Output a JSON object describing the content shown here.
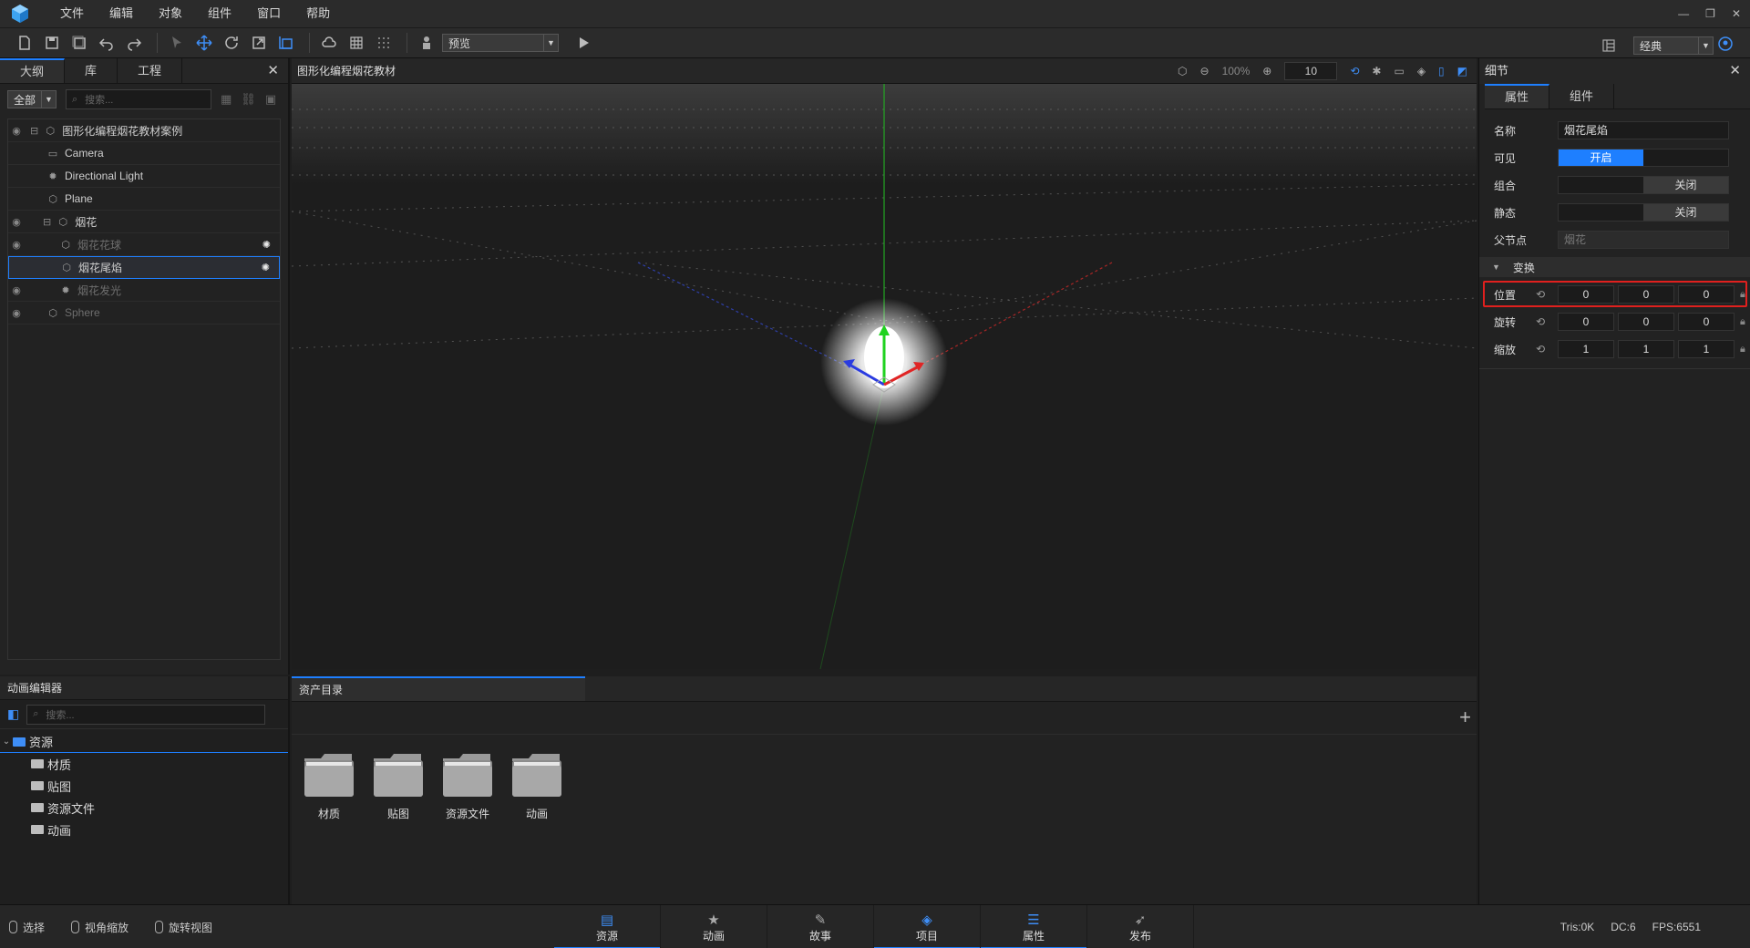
{
  "menu": [
    "文件",
    "编辑",
    "对象",
    "组件",
    "窗口",
    "帮助"
  ],
  "toolbar": {
    "preview_select": "预览",
    "layout_select": "经典"
  },
  "outline": {
    "tabs": [
      "大纲",
      "库",
      "工程"
    ],
    "filter_select": "全部",
    "search_placeholder": "搜索...",
    "tree": [
      {
        "label": "图形化编程烟花教材案例",
        "level": 0,
        "icon": "object-icon",
        "eye": true,
        "dim": false,
        "selected": false
      },
      {
        "label": "Camera",
        "level": 1,
        "icon": "camera-icon",
        "eye": false,
        "dim": false,
        "selected": false
      },
      {
        "label": "Directional Light",
        "level": 1,
        "icon": "light-icon",
        "eye": false,
        "dim": false,
        "selected": false
      },
      {
        "label": "Plane",
        "level": 1,
        "icon": "object-icon",
        "eye": false,
        "dim": false,
        "selected": false
      },
      {
        "label": "烟花",
        "level": 1,
        "icon": "object-icon",
        "eye": true,
        "dim": false,
        "selected": false
      },
      {
        "label": "烟花花球",
        "level": 2,
        "icon": "object-icon",
        "eye": true,
        "dim": true,
        "selected": false
      },
      {
        "label": "烟花尾焰",
        "level": 2,
        "icon": "object-icon",
        "eye": false,
        "dim": false,
        "selected": true
      },
      {
        "label": "烟花发光",
        "level": 2,
        "icon": "light-icon",
        "eye": true,
        "dim": true,
        "selected": false
      },
      {
        "label": "Sphere",
        "level": 1,
        "icon": "object-icon",
        "eye": true,
        "dim": true,
        "selected": false
      }
    ]
  },
  "viewport": {
    "title": "图形化编程烟花教材",
    "zoom": "100%",
    "grid_size": "10"
  },
  "details": {
    "title": "细节",
    "tabs": [
      "属性",
      "组件"
    ],
    "name_label": "名称",
    "name_value": "烟花尾焰",
    "visible_label": "可见",
    "visible_value": "开启",
    "group_label": "组合",
    "group_value": "关闭",
    "static_label": "静态",
    "static_value": "关闭",
    "parent_label": "父节点",
    "parent_value": "烟花",
    "transform_label": "变换",
    "position": {
      "label": "位置",
      "x": "0",
      "y": "0",
      "z": "0"
    },
    "rotation": {
      "label": "旋转",
      "x": "0",
      "y": "0",
      "z": "0"
    },
    "scale": {
      "label": "缩放",
      "x": "1",
      "y": "1",
      "z": "1"
    }
  },
  "anim_editor": {
    "title": "动画编辑器",
    "search_placeholder": "搜索...",
    "root": "资源",
    "children": [
      "材质",
      "贴图",
      "资源文件",
      "动画"
    ]
  },
  "asset_dir": {
    "tab": "资产目录",
    "folders": [
      "材质",
      "贴图",
      "资源文件",
      "动画"
    ]
  },
  "status": {
    "hints": [
      "选择",
      "视角缩放",
      "旋转视图"
    ],
    "tabs": [
      {
        "label": "资源",
        "icon": "resource-icon",
        "active": true
      },
      {
        "label": "动画",
        "icon": "animation-icon",
        "active": false
      },
      {
        "label": "故事",
        "icon": "story-icon",
        "active": false
      },
      {
        "label": "项目",
        "icon": "project-icon",
        "active": true
      },
      {
        "label": "属性",
        "icon": "properties-icon",
        "active": true
      },
      {
        "label": "发布",
        "icon": "publish-icon",
        "active": false
      }
    ],
    "tris": "Tris:0K",
    "dc": "DC:6",
    "fps": "FPS:6551"
  },
  "colors": {
    "accent": "#1e7fff",
    "highlight": "#e0201e",
    "axis_x": "#d22222",
    "axis_y": "#22c022",
    "axis_z": "#2244dd"
  }
}
